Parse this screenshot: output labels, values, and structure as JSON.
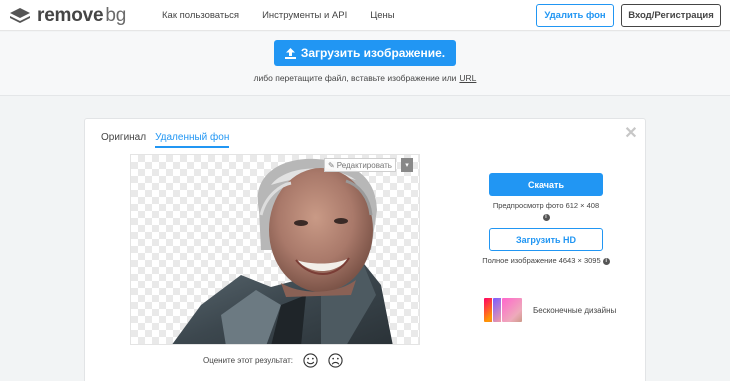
{
  "header": {
    "logo_main": "remove",
    "logo_bg": "bg",
    "nav": [
      "Как пользоваться",
      "Инструменты и API",
      "Цены"
    ],
    "remove_bg_button": "Удалить фон",
    "login_button": "Вход/Регистрация"
  },
  "upload": {
    "button_label": "Загрузить изображение.",
    "hint": "либо перетащите файл, вставьте изображение или",
    "hint_link": "URL"
  },
  "result": {
    "tabs": [
      {
        "label": "Оригинал",
        "active": false
      },
      {
        "label": "Удаленный фон",
        "active": true
      }
    ],
    "edit_label": "Редактировать",
    "rate_label": "Оцените этот результат:",
    "download_label": "Скачать",
    "preview_info": "Предпросмотр фото 612 × 408",
    "download_hd_label": "Загрузить HD",
    "hd_info": "Полное изображение 4643 × 3095",
    "designs_label": "Бесконечные дизайны",
    "close_symbol": "✕",
    "info_symbol": "i"
  },
  "colors": {
    "accent": "#2196f3",
    "text": "#454545",
    "band": "#f7f8f9"
  },
  "icons": {
    "logo": "layers-logo-icon",
    "upload": "upload-arrow-icon",
    "edit": "pencil-icon",
    "dropdown": "caret-down-icon",
    "close": "close-icon",
    "info": "info-icon",
    "happy": "smile-face-icon",
    "sad": "sad-face-icon"
  }
}
